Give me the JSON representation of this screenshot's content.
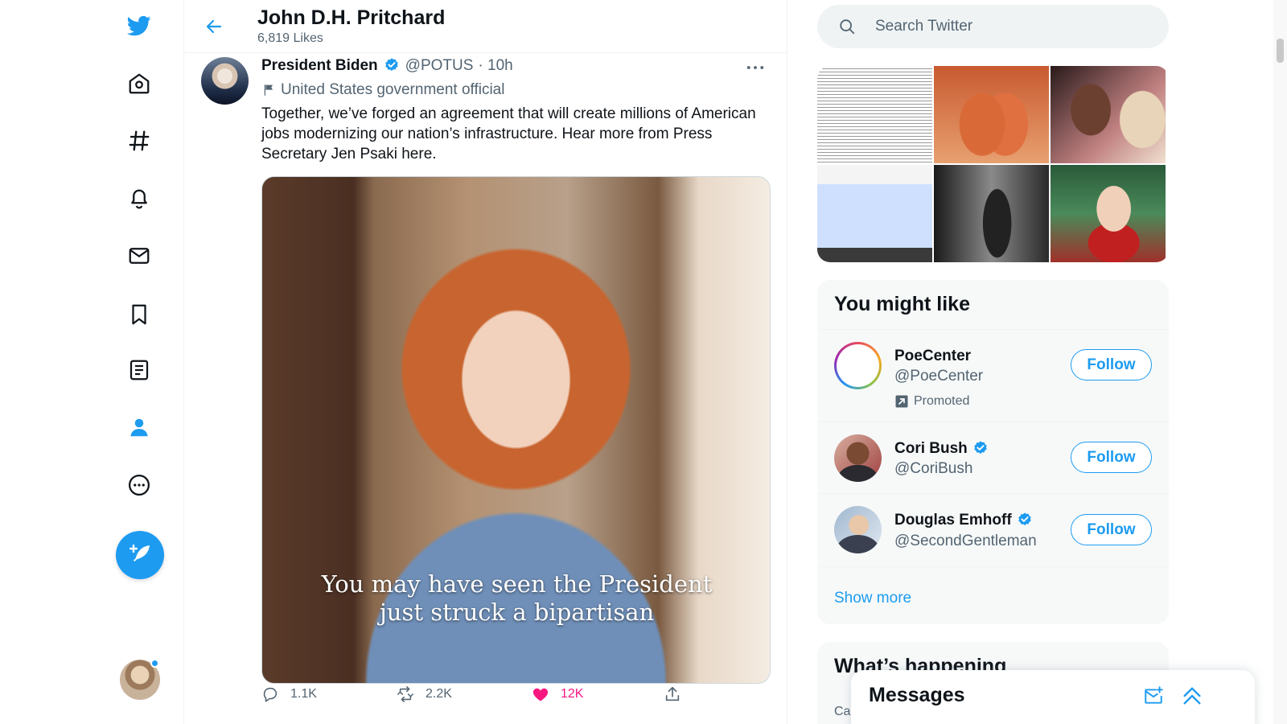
{
  "header": {
    "name": "John D.H. Pritchard",
    "subtitle": "6,819 Likes"
  },
  "tweet": {
    "author": "President Biden",
    "handle": "@POTUS",
    "time": "· 10h",
    "label": "United States government official",
    "text": "Together, we’ve forged an agreement that will create millions of American jobs modernizing our nation’s infrastructure. Hear more from Press Secretary Jen Psaki here.",
    "caption_line1": "You may have seen the President",
    "caption_line2": "just struck a bipartisan",
    "replies": "1.1K",
    "retweets": "2.2K",
    "likes": "12K",
    "liked_color": "#f91880"
  },
  "search": {
    "placeholder": "Search Twitter"
  },
  "who_to_follow": {
    "title": "You might like",
    "users": [
      {
        "name": "PoeCenter",
        "handle": "@PoeCenter",
        "promoted": "Promoted",
        "verified": false,
        "button": "Follow"
      },
      {
        "name": "Cori Bush",
        "handle": "@CoriBush",
        "verified": true,
        "button": "Follow"
      },
      {
        "name": "Douglas Emhoff",
        "handle": "@SecondGentleman",
        "verified": true,
        "button": "Follow"
      }
    ],
    "show_more": "Show more"
  },
  "happening": {
    "title": "What’s happening",
    "item": "Ca"
  },
  "messages": {
    "title": "Messages"
  },
  "colors": {
    "accent": "#1d9bf0",
    "like": "#f91880"
  }
}
